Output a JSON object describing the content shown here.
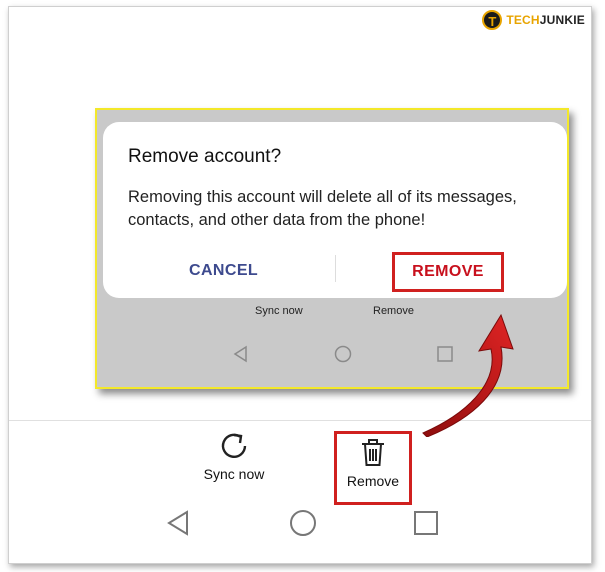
{
  "watermark": {
    "badge": "T",
    "brand_part1": "TECH",
    "brand_part2": "JUNKIE"
  },
  "dialog": {
    "title": "Remove account?",
    "message": "Removing this account will delete all of its messages, contacts, and other data from the phone!",
    "cancel_label": "CANCEL",
    "remove_label": "REMOVE"
  },
  "actions": {
    "sync_label": "Sync now",
    "remove_label": "Remove"
  },
  "icons": [
    "refresh-icon",
    "trash-icon",
    "back-icon",
    "home-icon",
    "recents-icon",
    "curved-arrow-icon"
  ],
  "colors": {
    "highlight_red": "#d0201f",
    "inset_border": "#f3e82a",
    "cancel_blue": "#3d4a8e"
  }
}
